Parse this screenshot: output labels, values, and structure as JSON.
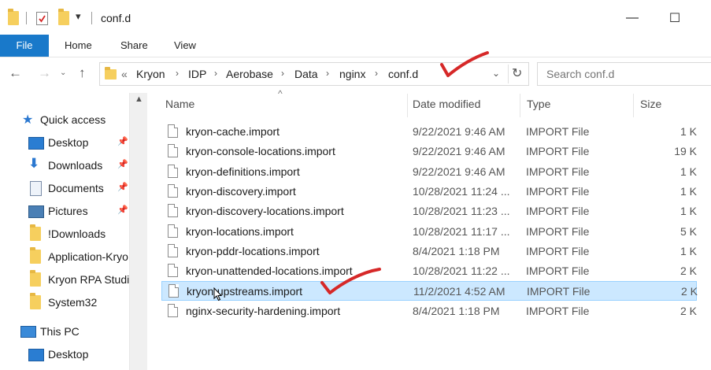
{
  "window": {
    "title": "conf.d",
    "controls": {
      "minimize": "—",
      "maximize": "☐"
    }
  },
  "ribbon": {
    "tabs": [
      "File",
      "Home",
      "Share",
      "View"
    ]
  },
  "address": {
    "overflow": "«",
    "crumbs": [
      "Kryon",
      "IDP",
      "Aerobase",
      "Data",
      "nginx",
      "conf.d"
    ]
  },
  "search": {
    "placeholder": "Search conf.d"
  },
  "nav": {
    "quick_access": "Quick access",
    "items": [
      {
        "label": "Desktop",
        "icon": "desktop-icon",
        "pinned": true
      },
      {
        "label": "Downloads",
        "icon": "download-arrow-icon",
        "pinned": true
      },
      {
        "label": "Documents",
        "icon": "documents-icon",
        "pinned": true
      },
      {
        "label": "Pictures",
        "icon": "pictures-icon",
        "pinned": true
      },
      {
        "label": "!Downloads",
        "icon": "folder-icon",
        "pinned": false
      },
      {
        "label": "Application-Kryo",
        "icon": "folder-icon",
        "pinned": false
      },
      {
        "label": "Kryon RPA Studi",
        "icon": "folder-icon",
        "pinned": false
      },
      {
        "label": "System32",
        "icon": "folder-icon",
        "pinned": false
      }
    ],
    "this_pc": "This PC",
    "pc_items": [
      {
        "label": "Desktop",
        "icon": "desktop-icon"
      }
    ]
  },
  "columns": {
    "name": "Name",
    "date": "Date modified",
    "type": "Type",
    "size": "Size"
  },
  "files": [
    {
      "name": "kryon-cache.import",
      "date": "9/22/2021 9:46 AM",
      "type": "IMPORT File",
      "size": "1 K"
    },
    {
      "name": "kryon-console-locations.import",
      "date": "9/22/2021 9:46 AM",
      "type": "IMPORT File",
      "size": "19 K"
    },
    {
      "name": "kryon-definitions.import",
      "date": "9/22/2021 9:46 AM",
      "type": "IMPORT File",
      "size": "1 K"
    },
    {
      "name": "kryon-discovery.import",
      "date": "10/28/2021 11:24 ...",
      "type": "IMPORT File",
      "size": "1 K"
    },
    {
      "name": "kryon-discovery-locations.import",
      "date": "10/28/2021 11:23 ...",
      "type": "IMPORT File",
      "size": "1 K"
    },
    {
      "name": "kryon-locations.import",
      "date": "10/28/2021 11:17 ...",
      "type": "IMPORT File",
      "size": "5 K"
    },
    {
      "name": "kryon-pddr-locations.import",
      "date": "8/4/2021 1:18 PM",
      "type": "IMPORT File",
      "size": "1 K"
    },
    {
      "name": "kryon-unattended-locations.import",
      "date": "10/28/2021 11:22 ...",
      "type": "IMPORT File",
      "size": "2 K"
    },
    {
      "name": "kryon-upstreams.import",
      "date": "11/2/2021 4:52 AM",
      "type": "IMPORT File",
      "size": "2 K",
      "selected": true
    },
    {
      "name": "nginx-security-hardening.import",
      "date": "8/4/2021 1:18 PM",
      "type": "IMPORT File",
      "size": "2 K"
    }
  ],
  "colors": {
    "accent": "#1979ca",
    "selection": "#cce8ff",
    "annotation": "#d62828",
    "folder": "#f6cf5e"
  }
}
